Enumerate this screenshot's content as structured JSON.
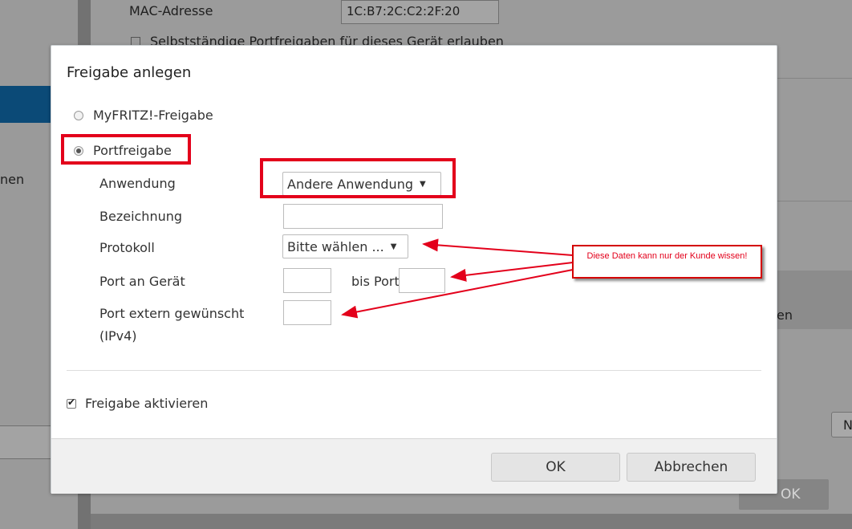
{
  "background": {
    "mac_label": "MAC-Adresse",
    "mac_value": "1C:B7:2C:C2:2F:20",
    "checkbox_label": "Selbstständige Portfreigaben für dieses Gerät erlauben",
    "left_text": "nen",
    "right_text": "en",
    "right_button": "N",
    "ok_button": "OK"
  },
  "dialog": {
    "title": "Freigabe anlegen",
    "radio_myfritz": "MyFRITZ!-Freigabe",
    "radio_portfreigabe": "Portfreigabe",
    "label_anwendung": "Anwendung",
    "select_anwendung": "Andere Anwendung",
    "label_bezeichnung": "Bezeichnung",
    "value_bezeichnung": "",
    "label_protokoll": "Protokoll",
    "select_protokoll": "Bitte wählen ...",
    "label_port": "Port an Gerät",
    "label_bisport": "bis Port",
    "label_extern": "Port extern gewünscht (IPv4)",
    "checkbox_aktivieren": "Freigabe aktivieren",
    "btn_ok": "OK",
    "btn_cancel": "Abbrechen"
  },
  "annotation": {
    "callout_text": "Diese Daten kann nur der Kunde wissen!",
    "color": "#e3001b"
  }
}
